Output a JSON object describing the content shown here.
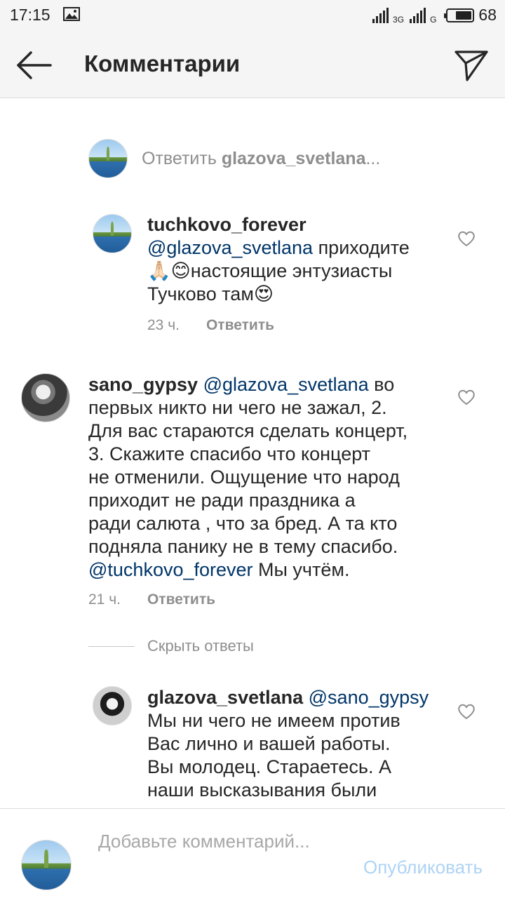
{
  "status_bar": {
    "time": "17:15",
    "network_1": "3G",
    "network_2": "G",
    "battery": "68",
    "battery_level": 0.68
  },
  "header": {
    "title": "Комментарии",
    "back_icon": "arrow-left-icon",
    "send_icon": "paper-plane-icon"
  },
  "reply_prompt": {
    "prefix": "Ответить ",
    "username": "glazova_svetlana",
    "suffix": "..."
  },
  "comments": [
    {
      "username": "tuchkovo_forever",
      "lines": [
        "@glazova_svetlana приходите",
        "🙏🏻😊настоящие энтузиасты",
        "Тучково там😍"
      ],
      "mention": "@glazova_svetlana",
      "time": "23 ч.",
      "reply_label": "Ответить"
    },
    {
      "username": "sano_gypsy",
      "mention_1": "@glazova_svetlana",
      "lines": [
        "во",
        "первых никто ни чего не зажал, 2.",
        "Для вас стараются сделать концерт,",
        "3.  Скажите спасибо что концерт",
        "не отменили. Ощущение что народ",
        "приходит не ради праздника а",
        "ради салюта , что за бред. А та кто",
        "подняла панику не в тему спасибо."
      ],
      "mention_2": "@tuchkovo_forever",
      "tail": " Мы учтём.",
      "time": "21 ч.",
      "reply_label": "Ответить"
    },
    {
      "username": "glazova_svetlana",
      "mention": "@sano_gypsy",
      "lines": [
        "Мы ни чего не имеем против",
        "Вас лично и вашей работы.",
        "Вы молодец. Стараетесь. А",
        "наши высказывания были"
      ]
    }
  ],
  "hide_replies": "Скрыть ответы",
  "composer": {
    "placeholder": "Добавьте комментарий...",
    "value": "",
    "publish_label": "Опубликовать"
  },
  "colors": {
    "mention": "#003569",
    "muted": "#8e8e8e",
    "publish_disabled": "#aed3f5"
  }
}
